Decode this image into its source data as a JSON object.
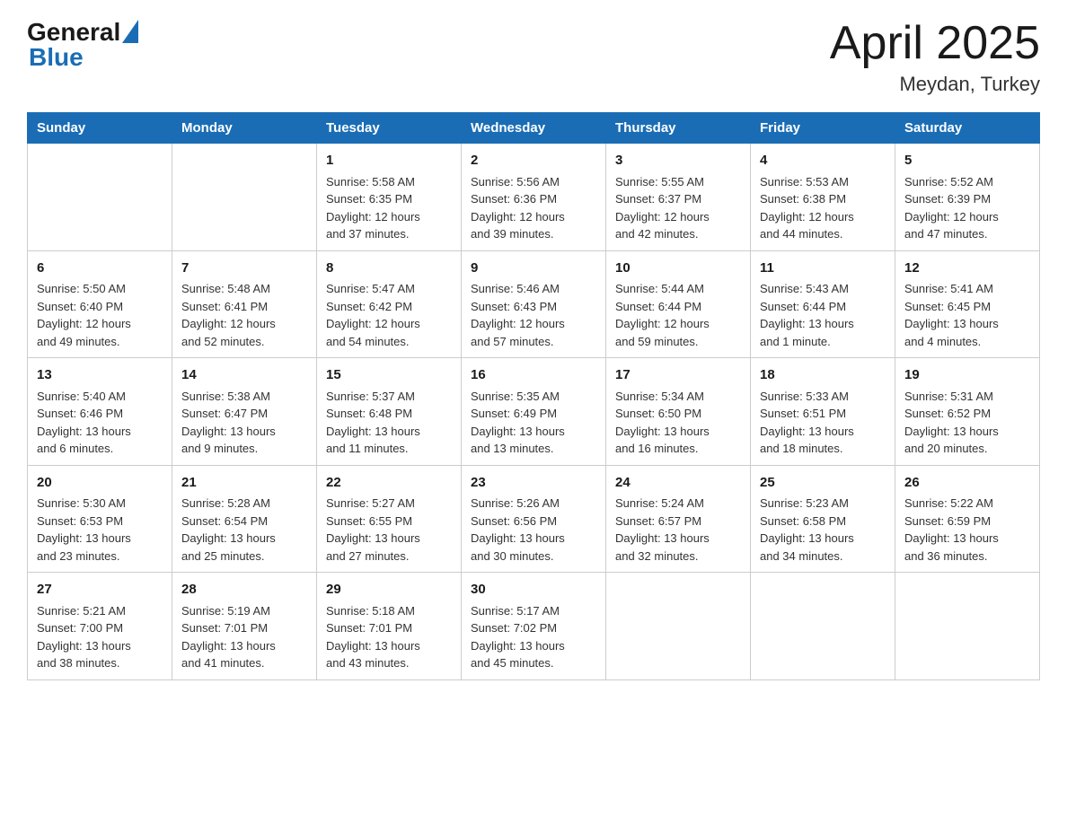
{
  "header": {
    "logo_general": "General",
    "logo_blue": "Blue",
    "month_year": "April 2025",
    "location": "Meydan, Turkey"
  },
  "weekdays": [
    "Sunday",
    "Monday",
    "Tuesday",
    "Wednesday",
    "Thursday",
    "Friday",
    "Saturday"
  ],
  "weeks": [
    [
      {
        "day": "",
        "info": ""
      },
      {
        "day": "",
        "info": ""
      },
      {
        "day": "1",
        "info": "Sunrise: 5:58 AM\nSunset: 6:35 PM\nDaylight: 12 hours\nand 37 minutes."
      },
      {
        "day": "2",
        "info": "Sunrise: 5:56 AM\nSunset: 6:36 PM\nDaylight: 12 hours\nand 39 minutes."
      },
      {
        "day": "3",
        "info": "Sunrise: 5:55 AM\nSunset: 6:37 PM\nDaylight: 12 hours\nand 42 minutes."
      },
      {
        "day": "4",
        "info": "Sunrise: 5:53 AM\nSunset: 6:38 PM\nDaylight: 12 hours\nand 44 minutes."
      },
      {
        "day": "5",
        "info": "Sunrise: 5:52 AM\nSunset: 6:39 PM\nDaylight: 12 hours\nand 47 minutes."
      }
    ],
    [
      {
        "day": "6",
        "info": "Sunrise: 5:50 AM\nSunset: 6:40 PM\nDaylight: 12 hours\nand 49 minutes."
      },
      {
        "day": "7",
        "info": "Sunrise: 5:48 AM\nSunset: 6:41 PM\nDaylight: 12 hours\nand 52 minutes."
      },
      {
        "day": "8",
        "info": "Sunrise: 5:47 AM\nSunset: 6:42 PM\nDaylight: 12 hours\nand 54 minutes."
      },
      {
        "day": "9",
        "info": "Sunrise: 5:46 AM\nSunset: 6:43 PM\nDaylight: 12 hours\nand 57 minutes."
      },
      {
        "day": "10",
        "info": "Sunrise: 5:44 AM\nSunset: 6:44 PM\nDaylight: 12 hours\nand 59 minutes."
      },
      {
        "day": "11",
        "info": "Sunrise: 5:43 AM\nSunset: 6:44 PM\nDaylight: 13 hours\nand 1 minute."
      },
      {
        "day": "12",
        "info": "Sunrise: 5:41 AM\nSunset: 6:45 PM\nDaylight: 13 hours\nand 4 minutes."
      }
    ],
    [
      {
        "day": "13",
        "info": "Sunrise: 5:40 AM\nSunset: 6:46 PM\nDaylight: 13 hours\nand 6 minutes."
      },
      {
        "day": "14",
        "info": "Sunrise: 5:38 AM\nSunset: 6:47 PM\nDaylight: 13 hours\nand 9 minutes."
      },
      {
        "day": "15",
        "info": "Sunrise: 5:37 AM\nSunset: 6:48 PM\nDaylight: 13 hours\nand 11 minutes."
      },
      {
        "day": "16",
        "info": "Sunrise: 5:35 AM\nSunset: 6:49 PM\nDaylight: 13 hours\nand 13 minutes."
      },
      {
        "day": "17",
        "info": "Sunrise: 5:34 AM\nSunset: 6:50 PM\nDaylight: 13 hours\nand 16 minutes."
      },
      {
        "day": "18",
        "info": "Sunrise: 5:33 AM\nSunset: 6:51 PM\nDaylight: 13 hours\nand 18 minutes."
      },
      {
        "day": "19",
        "info": "Sunrise: 5:31 AM\nSunset: 6:52 PM\nDaylight: 13 hours\nand 20 minutes."
      }
    ],
    [
      {
        "day": "20",
        "info": "Sunrise: 5:30 AM\nSunset: 6:53 PM\nDaylight: 13 hours\nand 23 minutes."
      },
      {
        "day": "21",
        "info": "Sunrise: 5:28 AM\nSunset: 6:54 PM\nDaylight: 13 hours\nand 25 minutes."
      },
      {
        "day": "22",
        "info": "Sunrise: 5:27 AM\nSunset: 6:55 PM\nDaylight: 13 hours\nand 27 minutes."
      },
      {
        "day": "23",
        "info": "Sunrise: 5:26 AM\nSunset: 6:56 PM\nDaylight: 13 hours\nand 30 minutes."
      },
      {
        "day": "24",
        "info": "Sunrise: 5:24 AM\nSunset: 6:57 PM\nDaylight: 13 hours\nand 32 minutes."
      },
      {
        "day": "25",
        "info": "Sunrise: 5:23 AM\nSunset: 6:58 PM\nDaylight: 13 hours\nand 34 minutes."
      },
      {
        "day": "26",
        "info": "Sunrise: 5:22 AM\nSunset: 6:59 PM\nDaylight: 13 hours\nand 36 minutes."
      }
    ],
    [
      {
        "day": "27",
        "info": "Sunrise: 5:21 AM\nSunset: 7:00 PM\nDaylight: 13 hours\nand 38 minutes."
      },
      {
        "day": "28",
        "info": "Sunrise: 5:19 AM\nSunset: 7:01 PM\nDaylight: 13 hours\nand 41 minutes."
      },
      {
        "day": "29",
        "info": "Sunrise: 5:18 AM\nSunset: 7:01 PM\nDaylight: 13 hours\nand 43 minutes."
      },
      {
        "day": "30",
        "info": "Sunrise: 5:17 AM\nSunset: 7:02 PM\nDaylight: 13 hours\nand 45 minutes."
      },
      {
        "day": "",
        "info": ""
      },
      {
        "day": "",
        "info": ""
      },
      {
        "day": "",
        "info": ""
      }
    ]
  ]
}
